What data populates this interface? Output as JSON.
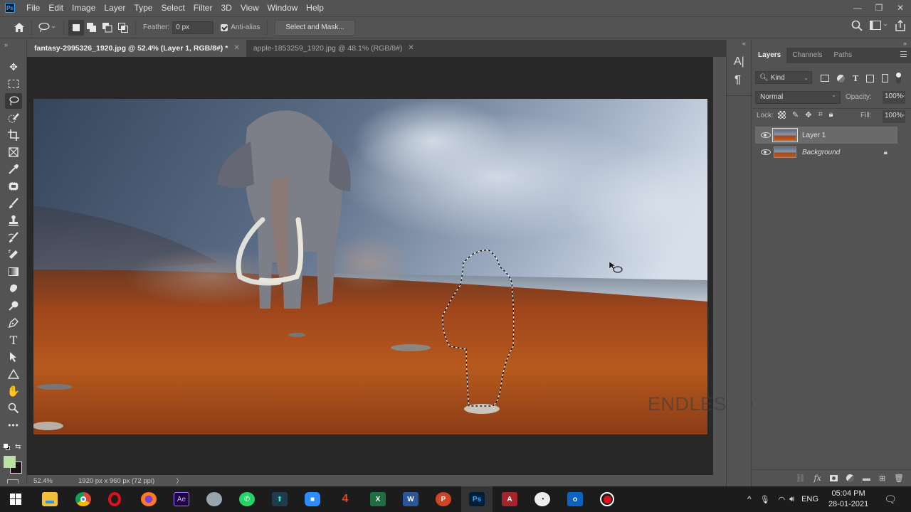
{
  "app": {
    "logo": "Ps",
    "menu": [
      "File",
      "Edit",
      "Image",
      "Layer",
      "Type",
      "Select",
      "Filter",
      "3D",
      "View",
      "Window",
      "Help"
    ],
    "window_controls": {
      "minimize": "—",
      "restore": "❐",
      "close": "✕"
    }
  },
  "options_bar": {
    "tool_icon": "lasso-icon",
    "feather_label": "Feather:",
    "feather_value": "0 px",
    "antialias_label": "Anti-alias",
    "antialias_checked": true,
    "select_mask_label": "Select and Mask..."
  },
  "tabs": [
    {
      "label": "fantasy-2995326_1920.jpg @ 52.4% (Layer 1, RGB/8#) *",
      "active": true
    },
    {
      "label": "apple-1853259_1920.jpg @ 48.1% (RGB/8#)",
      "active": false
    }
  ],
  "tools": [
    "move",
    "rectangular-marquee",
    "lasso",
    "object-selection",
    "crop",
    "frame",
    "eyedropper",
    "spot-healing",
    "brush",
    "clone-stamp",
    "history-brush",
    "eraser",
    "gradient",
    "blur",
    "dodge",
    "pen",
    "type",
    "path-selection",
    "shape",
    "hand",
    "zoom",
    "more"
  ],
  "colors": {
    "foreground": "#b9e4a1",
    "background": "#1e1416"
  },
  "status": {
    "zoom": "52.4%",
    "doc_info": "1920 px x 960 px (72 ppi)",
    "arrow": "〉"
  },
  "watermark": "ENDLESS KNOWLEDGE",
  "layers_panel": {
    "tabs": [
      "Layers",
      "Channels",
      "Paths"
    ],
    "filter_label": "Kind",
    "blend_mode": "Normal",
    "opacity_label": "Opacity:",
    "opacity_value": "100%",
    "lock_label": "Lock:",
    "fill_label": "Fill:",
    "fill_value": "100%",
    "layers": [
      {
        "name": "Layer 1",
        "visible": true,
        "selected": true,
        "locked": false
      },
      {
        "name": "Background",
        "visible": true,
        "selected": false,
        "locked": true
      }
    ]
  },
  "taskbar": {
    "apps": [
      "Start",
      "File Explorer",
      "Chrome",
      "Opera",
      "Firefox",
      "After Effects",
      "Camera",
      "WhatsApp",
      "App",
      "Zoom",
      "Acrobat",
      "Excel",
      "Word",
      "PowerPoint",
      "Photoshop",
      "Access",
      "Speedtest",
      "Outlook",
      "Recorder"
    ],
    "language": "ENG",
    "time": "05:04 PM",
    "date": "28-01-2021"
  }
}
